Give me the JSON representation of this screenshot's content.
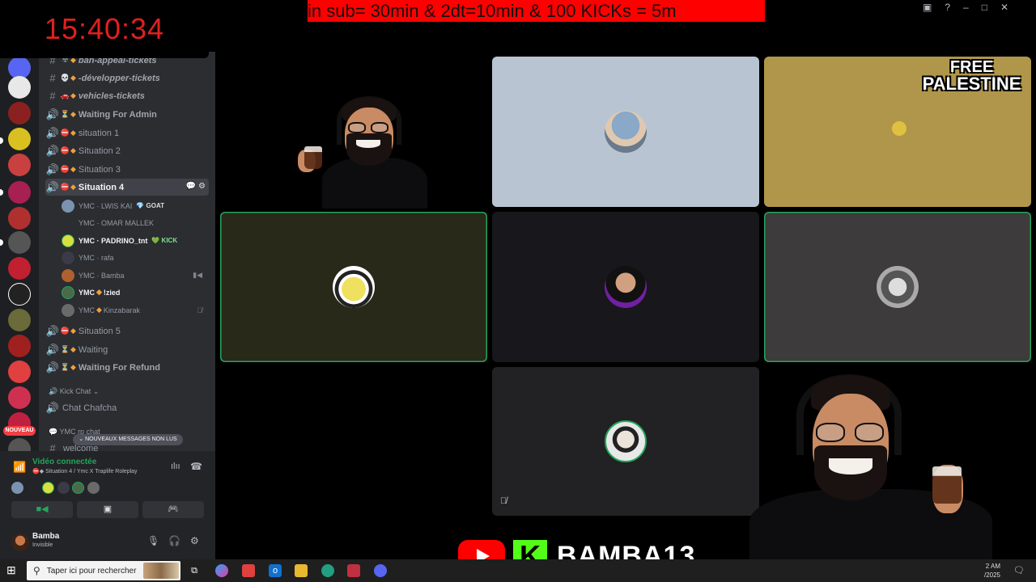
{
  "overlay": {
    "clock": "15:40:34",
    "ticker": "in     sub= 30min  &  2dt=10min  &  100 KICKs = 5m",
    "free_palestine": [
      "FREE",
      "PALESTINE"
    ],
    "brand": "BAMBA13"
  },
  "servers": {
    "new_badge": "NOUVEAU"
  },
  "channels": [
    {
      "type": "text",
      "emoji": "☢",
      "name": "ban-appeal-tickets",
      "style": "italic"
    },
    {
      "type": "text",
      "emoji": "💀",
      "name": "-développer-tickets",
      "style": "italic"
    },
    {
      "type": "text",
      "emoji": "🚗",
      "name": "vehicles-tickets",
      "style": "italic"
    },
    {
      "type": "voice",
      "emoji": "⏳",
      "name": "Waiting For Admin",
      "style": "bold"
    },
    {
      "type": "voice",
      "emoji": "⛔",
      "name": "situation 1",
      "style": "plain"
    },
    {
      "type": "voice",
      "emoji": "⛔",
      "name": "Situation 2",
      "style": "plain"
    },
    {
      "type": "voice",
      "emoji": "⛔",
      "name": "Situation 3",
      "style": "plain"
    },
    {
      "type": "voice",
      "emoji": "⛔",
      "name": "Situation 4",
      "style": "active"
    }
  ],
  "members": [
    {
      "prefix": "YMC",
      "name": "LWIS KAI",
      "tag": "GOAT",
      "tag_icon": "💎",
      "highlight": false
    },
    {
      "prefix": "YMC",
      "name": "OMAR MALLEK",
      "tag": "",
      "tag_icon": "",
      "highlight": false
    },
    {
      "prefix": "YMC",
      "name": "PADRINO_tnt",
      "tag": "KICK",
      "tag_icon": "💚",
      "highlight": true
    },
    {
      "prefix": "YMC",
      "name": "rafa",
      "tag": "",
      "tag_icon": "",
      "highlight": false
    },
    {
      "prefix": "YMC",
      "name": "Bamba",
      "tag": "",
      "tag_icon": "",
      "highlight": false,
      "right_icon": "camera-icon"
    },
    {
      "prefix": "YMC",
      "name": "!zied",
      "tag": "",
      "tag_icon": "",
      "highlight": true
    },
    {
      "prefix": "YMC",
      "name": "Kinzabarak",
      "tag": "",
      "tag_icon": "",
      "highlight": false,
      "right_icon": "muted-icon"
    }
  ],
  "channels_after": [
    {
      "type": "voice",
      "emoji": "⛔",
      "name": "Situation 5",
      "style": "plain"
    },
    {
      "type": "voice",
      "emoji": "⏳",
      "name": "Waiting",
      "style": "plain"
    },
    {
      "type": "voice",
      "emoji": "⏳",
      "name": "Waiting For Refund",
      "style": "bold"
    }
  ],
  "category": "Kick Chat",
  "chat_channel": "Chat Chafcha",
  "partial_category": "YMC rp chat",
  "partial_channel": "welcome",
  "unread_pill": "NOUVEAUX MESSAGES NON LUS",
  "voice": {
    "status": "Vidéo connectée",
    "location": "Situation 4 / Ymc X Traplife Roleplay"
  },
  "user": {
    "name": "Bamba",
    "status": "Invisible"
  },
  "taskbar": {
    "search_placeholder": "Taper ici pour rechercher",
    "time": "2 AM",
    "date": "/2025"
  },
  "colors": {
    "discord_dark": "#2b2d31",
    "speaking_green": "#23a55a",
    "ticker_red": "#ff0000",
    "clock_red": "#e02020",
    "kick_green": "#53fc18"
  }
}
